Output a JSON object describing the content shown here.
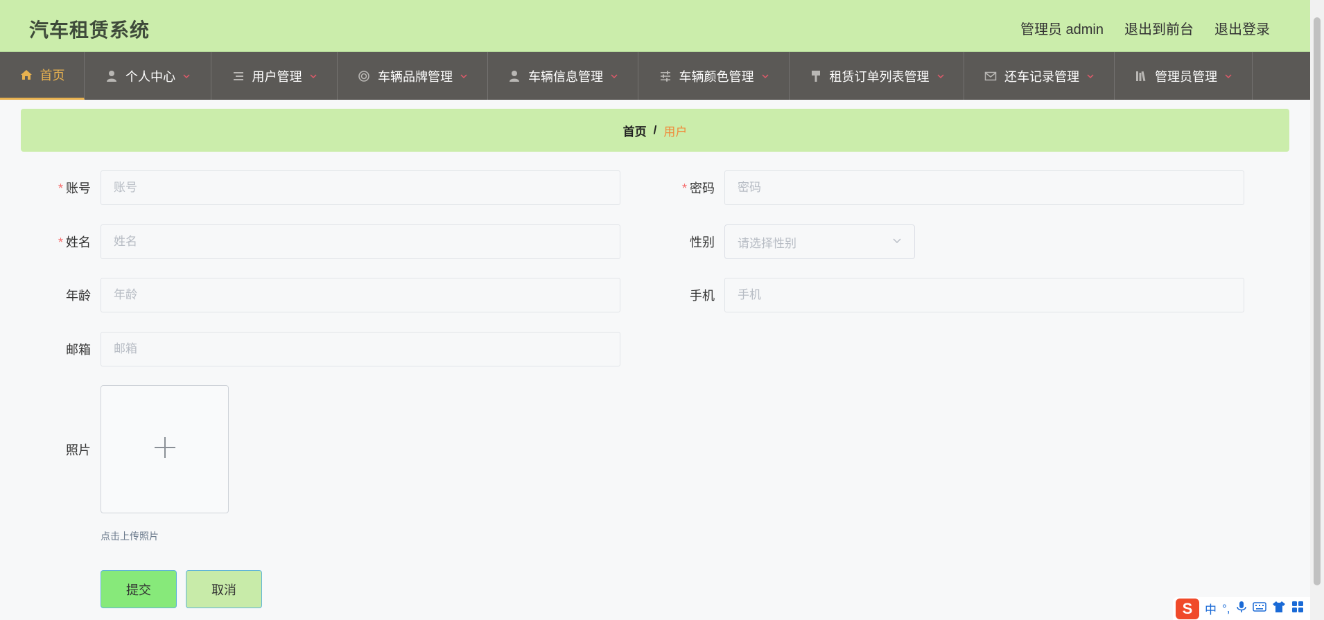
{
  "header": {
    "app_title": "汽车租赁系统",
    "admin_label": "管理员 admin",
    "to_front": "退出到前台",
    "logout": "退出登录"
  },
  "nav": {
    "items": [
      {
        "label": "首页",
        "icon": "home-icon",
        "active": true
      },
      {
        "label": "个人中心",
        "icon": "user-icon"
      },
      {
        "label": "用户管理",
        "icon": "list-icon"
      },
      {
        "label": "车辆品牌管理",
        "icon": "ring-icon"
      },
      {
        "label": "车辆信息管理",
        "icon": "person-icon"
      },
      {
        "label": "车辆颜色管理",
        "icon": "sliders-icon"
      },
      {
        "label": "租赁订单列表管理",
        "icon": "brush-icon"
      },
      {
        "label": "还车记录管理",
        "icon": "mail-icon"
      },
      {
        "label": "管理员管理",
        "icon": "books-icon"
      }
    ]
  },
  "breadcrumb": {
    "home": "首页",
    "separator": "/",
    "current": "用户"
  },
  "form": {
    "account_label": "账号",
    "account_placeholder": "账号",
    "password_label": "密码",
    "password_placeholder": "密码",
    "name_label": "姓名",
    "name_placeholder": "姓名",
    "gender_label": "性别",
    "gender_placeholder": "请选择性别",
    "age_label": "年龄",
    "age_placeholder": "年龄",
    "phone_label": "手机",
    "phone_placeholder": "手机",
    "email_label": "邮箱",
    "email_placeholder": "邮箱",
    "photo_label": "照片",
    "photo_tip": "点击上传照片",
    "required_mark": "*"
  },
  "buttons": {
    "submit": "提交",
    "cancel": "取消"
  },
  "ime": {
    "logo": "S",
    "mode": "中",
    "punct": "°,"
  },
  "colors": {
    "header_bg": "#cbedab",
    "nav_bg": "#5b5956",
    "active_accent": "#e9b24f",
    "breadcrumb_current": "#f08a3a",
    "submit_bg": "#87e97a",
    "cancel_bg": "#c8eba9",
    "required": "#f56c6c"
  }
}
